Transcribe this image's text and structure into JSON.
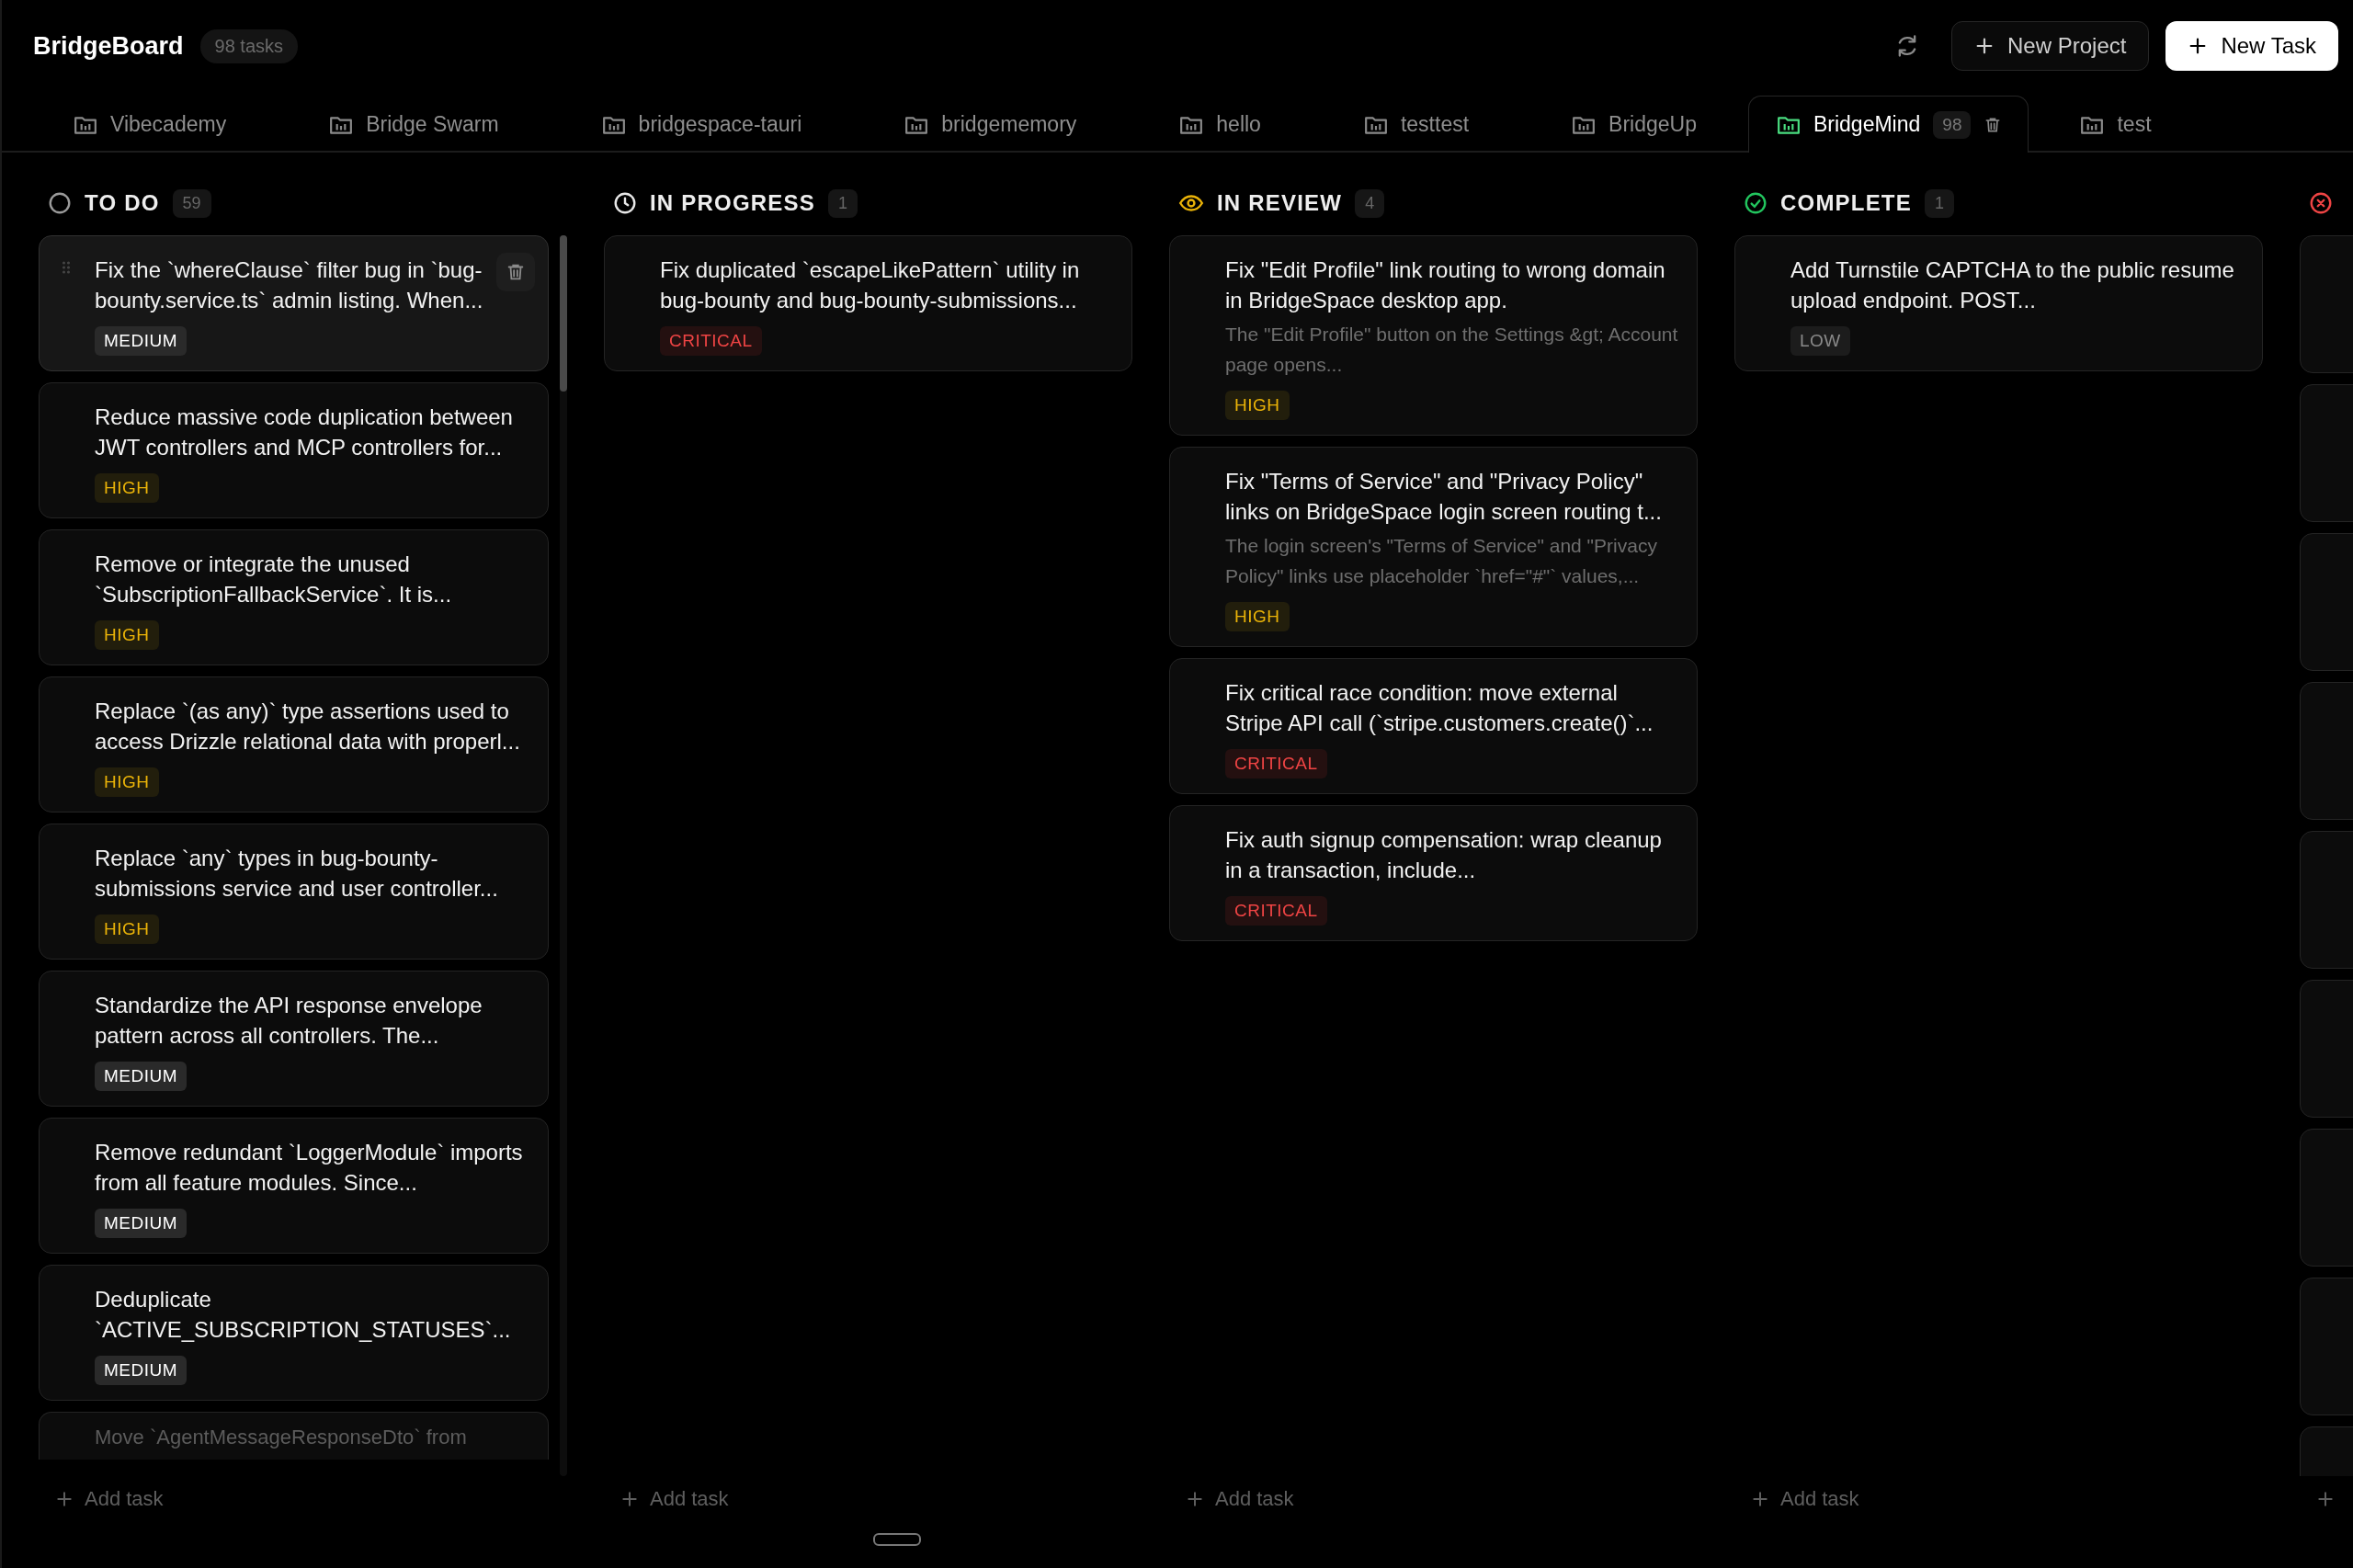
{
  "app": {
    "title": "BridgeBoard",
    "task_count": "98 tasks"
  },
  "actions": {
    "new_project": "New Project",
    "new_task": "New Task"
  },
  "tabs": [
    {
      "label": "Vibecademy",
      "selected": false
    },
    {
      "label": "Bridge Swarm",
      "selected": false
    },
    {
      "label": "bridgespace-tauri",
      "selected": false
    },
    {
      "label": "bridgememory",
      "selected": false
    },
    {
      "label": "hello",
      "selected": false
    },
    {
      "label": "testtest",
      "selected": false
    },
    {
      "label": "BridgeUp",
      "selected": false
    },
    {
      "label": "BridgeMind",
      "selected": true,
      "count": "98"
    },
    {
      "label": "test",
      "selected": false
    }
  ],
  "columns": [
    {
      "kind": "todo",
      "title": "TO DO",
      "count": "59",
      "add_label": "Add task",
      "cards": [
        {
          "kind": "task",
          "hovered": true,
          "title": "Fix the `whereClause` filter bug in `bug-bounty.service.ts` admin listing. When...",
          "priority": "MEDIUM"
        },
        {
          "kind": "task",
          "hovered": false,
          "title": "Reduce massive code duplication between JWT controllers and MCP controllers for...",
          "priority": "HIGH"
        },
        {
          "kind": "task",
          "hovered": false,
          "title": "Remove or integrate the unused `SubscriptionFallbackService`. It is...",
          "priority": "HIGH"
        },
        {
          "kind": "task",
          "hovered": false,
          "title": "Replace `(as any)` type assertions used to access Drizzle relational data with properl...",
          "priority": "HIGH"
        },
        {
          "kind": "task",
          "hovered": false,
          "title": "Replace `any` types in bug-bounty-submissions service and user controller...",
          "priority": "HIGH"
        },
        {
          "kind": "task",
          "hovered": false,
          "title": "Standardize the API response envelope pattern across all controllers. The...",
          "priority": "MEDIUM"
        },
        {
          "kind": "task",
          "hovered": false,
          "title": "Remove redundant `LoggerModule` imports from all feature modules. Since...",
          "priority": "MEDIUM"
        },
        {
          "kind": "task",
          "hovered": false,
          "title": "Deduplicate `ACTIVE_SUBSCRIPTION_STATUSES`...",
          "priority": "MEDIUM"
        },
        {
          "kind": "partial",
          "hovered": false,
          "title": "Move `AgentMessageResponseDto` from"
        }
      ]
    },
    {
      "kind": "in_progress",
      "title": "IN PROGRESS",
      "count": "1",
      "add_label": "Add task",
      "cards": [
        {
          "kind": "task",
          "hovered": false,
          "title": "Fix duplicated `escapeLikePattern` utility in bug-bounty and bug-bounty-submissions...",
          "priority": "CRITICAL"
        }
      ]
    },
    {
      "kind": "in_review",
      "title": "IN REVIEW",
      "count": "4",
      "add_label": "Add task",
      "cards": [
        {
          "kind": "task",
          "hovered": false,
          "title": "Fix \"Edit Profile\" link routing to wrong domain in BridgeSpace desktop app.",
          "description": "The \"Edit Profile\" button on the Settings &gt; Account page opens...",
          "priority": "HIGH"
        },
        {
          "kind": "task",
          "hovered": false,
          "title": "Fix \"Terms of Service\" and \"Privacy Policy\" links on BridgeSpace login screen routing t...",
          "description": "The login screen's \"Terms of Service\" and \"Privacy Policy\" links use placeholder `href=\"#\"` values,...",
          "priority": "HIGH"
        },
        {
          "kind": "task",
          "hovered": false,
          "title": "Fix critical race condition: move external Stripe API call (`stripe.customers.create()`...",
          "priority": "CRITICAL"
        },
        {
          "kind": "task",
          "hovered": false,
          "title": "Fix auth signup compensation: wrap cleanup in a transaction, include...",
          "priority": "CRITICAL"
        }
      ]
    },
    {
      "kind": "complete",
      "title": "COMPLETE",
      "count": "1",
      "add_label": "Add task",
      "cards": [
        {
          "kind": "task",
          "hovered": false,
          "title": "Add Turnstile CAPTCHA to the public resume upload endpoint. POST...",
          "priority": "LOW"
        }
      ]
    },
    {
      "kind": "cancelled",
      "cards": [
        {
          "kind": "blank"
        },
        {
          "kind": "blank"
        },
        {
          "kind": "blank"
        },
        {
          "kind": "blank"
        },
        {
          "kind": "blank"
        },
        {
          "kind": "blank"
        },
        {
          "kind": "blank"
        },
        {
          "kind": "blank"
        },
        {
          "kind": "blank"
        }
      ]
    }
  ]
}
